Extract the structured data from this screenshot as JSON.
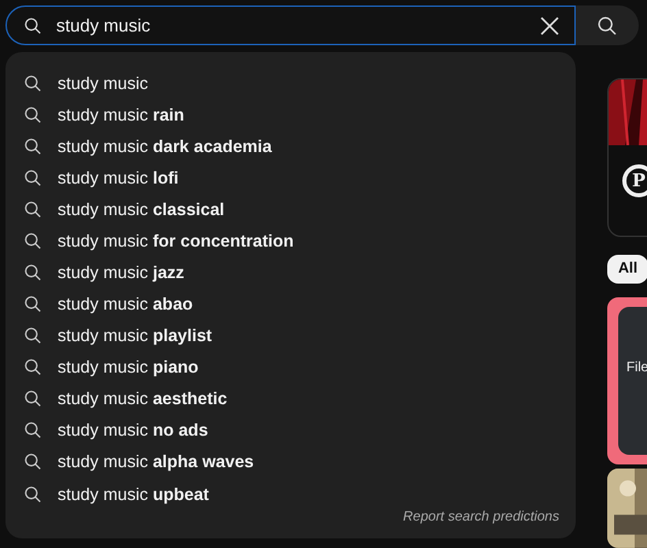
{
  "search": {
    "value": "study music"
  },
  "suggestions": [
    {
      "prefix": "study music"
    },
    {
      "prefix": "study music",
      "completion": "rain"
    },
    {
      "prefix": "study music",
      "completion": "dark academia"
    },
    {
      "prefix": "study music",
      "completion": "lofi"
    },
    {
      "prefix": "study music",
      "completion": "classical"
    },
    {
      "prefix": "study music",
      "completion": "for concentration"
    },
    {
      "prefix": "study music",
      "completion": "jazz"
    },
    {
      "prefix": "study music",
      "completion": "abao"
    },
    {
      "prefix": "study music",
      "completion": "playlist"
    },
    {
      "prefix": "study music",
      "completion": "piano"
    },
    {
      "prefix": "study music",
      "completion": "aesthetic"
    },
    {
      "prefix": "study music",
      "completion": "no ads"
    },
    {
      "prefix": "study music",
      "completion": "alpha waves"
    },
    {
      "prefix": "study music",
      "completion": "upbeat"
    }
  ],
  "report_link": "Report search predictions",
  "background": {
    "channel_logo": "P",
    "chips": [
      {
        "label": "All",
        "selected": true
      }
    ],
    "card_text": "File"
  }
}
